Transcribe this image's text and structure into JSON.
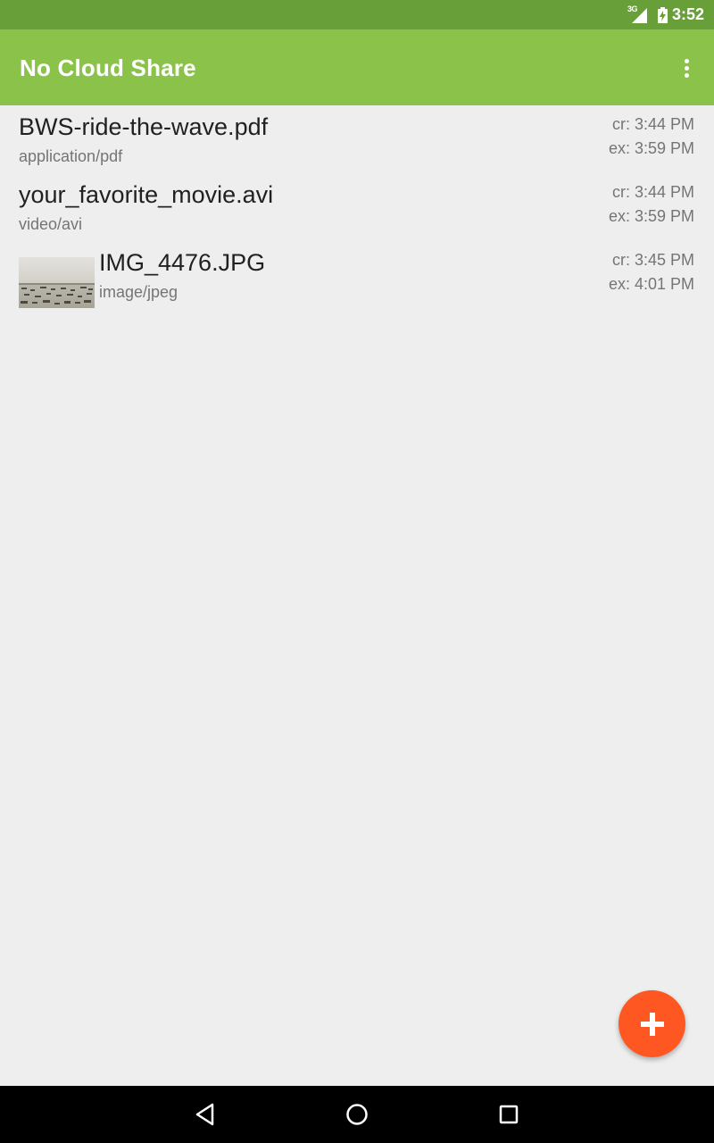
{
  "status_bar": {
    "network_type": "3G",
    "time": "3:52",
    "icons": [
      "signal-icon",
      "battery-charging-icon"
    ]
  },
  "app_bar": {
    "title": "No Cloud Share",
    "menu_icon": "overflow-menu-icon"
  },
  "files": [
    {
      "name": "BWS-ride-the-wave.pdf",
      "mime": "application/pdf",
      "created": "cr: 3:44 PM",
      "expires": "ex: 3:59 PM",
      "has_thumbnail": false
    },
    {
      "name": "your_favorite_movie.avi",
      "mime": "video/avi",
      "created": "cr: 3:44 PM",
      "expires": "ex: 3:59 PM",
      "has_thumbnail": false
    },
    {
      "name": "IMG_4476.JPG",
      "mime": "image/jpeg",
      "created": "cr: 3:45 PM",
      "expires": "ex: 4:01 PM",
      "has_thumbnail": true
    }
  ],
  "fab": {
    "icon": "plus-icon"
  },
  "navigation": {
    "buttons": [
      "back-icon",
      "home-icon",
      "recents-icon"
    ]
  },
  "colors": {
    "status_bar": "#689f38",
    "app_bar": "#8bc34a",
    "fab": "#ff5722",
    "background": "#eeeeee",
    "primary_text": "#212121",
    "secondary_text": "#757575"
  }
}
